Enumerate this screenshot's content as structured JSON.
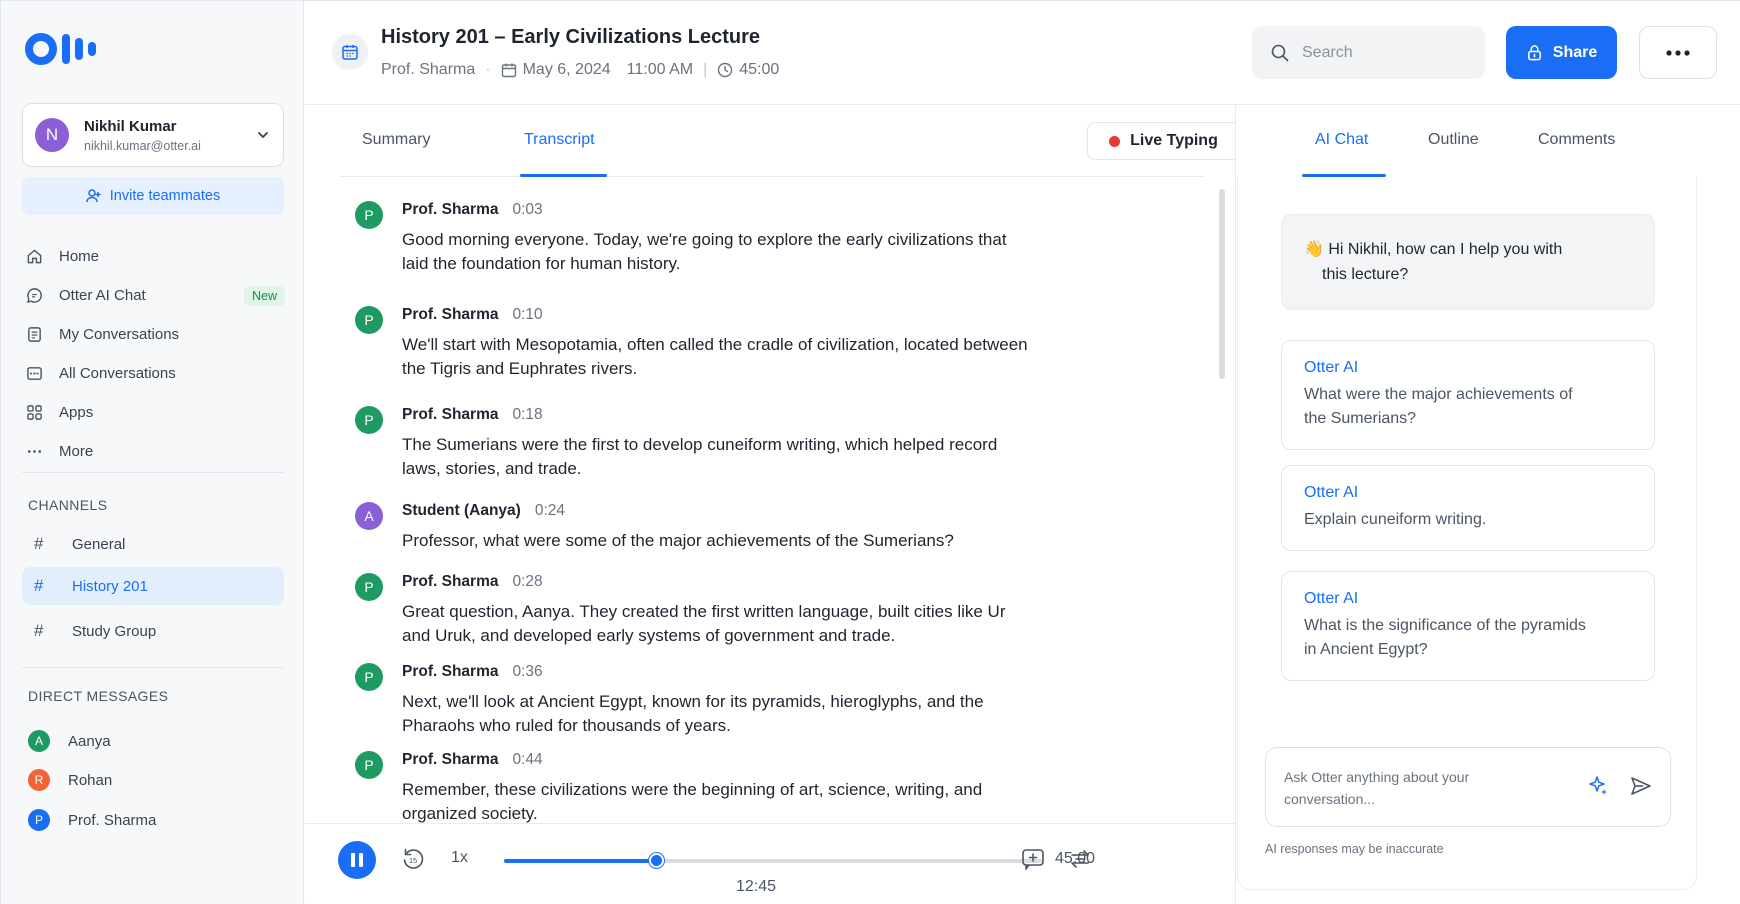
{
  "colors": {
    "accent": "#1a6ef5",
    "green_avatar": "#1e9a63",
    "purple_avatar": "#8b5fd6",
    "orange_avatar": "#f06437",
    "blue_avatar": "#1a6ef5",
    "live_dot": "#e53935"
  },
  "sidebar": {
    "user": {
      "initial": "N",
      "name": "Nikhil Kumar",
      "email": "nikhil.kumar@otter.ai"
    },
    "invite_label": "Invite teammates",
    "nav": [
      {
        "label": "Home",
        "icon": "home-icon"
      },
      {
        "label": "Otter AI Chat",
        "icon": "chat-icon",
        "badge": "New"
      },
      {
        "label": "My Conversations",
        "icon": "document-icon"
      },
      {
        "label": "All Conversations",
        "icon": "conversations-icon"
      },
      {
        "label": "Apps",
        "icon": "grid-icon"
      },
      {
        "label": "More",
        "icon": "more-dots-icon"
      }
    ],
    "channels_title": "CHANNELS",
    "channels": [
      {
        "label": "General"
      },
      {
        "label": "History 201"
      },
      {
        "label": "Study Group"
      }
    ],
    "dm_title": "DIRECT MESSAGES",
    "dms": [
      {
        "initial": "A",
        "name": "Aanya"
      },
      {
        "initial": "R",
        "name": "Rohan"
      },
      {
        "initial": "P",
        "name": "Prof. Sharma"
      }
    ]
  },
  "header": {
    "title": "History 201 – Early Civilizations Lecture",
    "speaker": "Prof. Sharma",
    "date": "May 6, 2024",
    "time": "11:00 AM",
    "duration": "45:00",
    "search_placeholder": "Search",
    "share_label": "Share"
  },
  "transcript_tabs": {
    "summary": "Summary",
    "transcript": "Transcript",
    "live_typing": "Live Typing"
  },
  "transcript": [
    {
      "initial": "P",
      "speaker": "Prof. Sharma",
      "time": "0:03",
      "text": "Good morning everyone. Today, we're going to explore the early civilizations that laid the foundation for human history."
    },
    {
      "initial": "P",
      "speaker": "Prof. Sharma",
      "time": "0:10",
      "text": "We'll start with Mesopotamia, often called the cradle of civilization, located between the Tigris and Euphrates rivers."
    },
    {
      "initial": "P",
      "speaker": "Prof. Sharma",
      "time": "0:18",
      "text": "The Sumerians were the first to develop cuneiform writing, which helped record laws, stories, and trade."
    },
    {
      "initial": "A",
      "speaker": "Student (Aanya)",
      "time": "0:24",
      "text": "Professor, what were some of the major achievements of the Sumerians?"
    },
    {
      "initial": "P",
      "speaker": "Prof. Sharma",
      "time": "0:28",
      "text": "Great question, Aanya. They created the first written language, built cities like Ur and Uruk, and developed early systems of government and trade."
    },
    {
      "initial": "P",
      "speaker": "Prof. Sharma",
      "time": "0:36",
      "text": "Next, we'll look at Ancient Egypt, known for its pyramids, hieroglyphs, and the Pharaohs who ruled for thousands of years."
    },
    {
      "initial": "P",
      "speaker": "Prof. Sharma",
      "time": "0:44",
      "text": "Remember, these civilizations were the beginning of art, science, writing, and organized society."
    }
  ],
  "player": {
    "speed": "1x",
    "current": "12:45",
    "total": "45:00",
    "progress": 0.283
  },
  "right_panel": {
    "tabs": {
      "ai_chat": "AI Chat",
      "outline": "Outline",
      "comments": "Comments"
    },
    "greeting_line1": "👋 Hi Nikhil, how can I help you with",
    "greeting_line2": "this lecture?",
    "suggestions": [
      {
        "source": "Otter AI",
        "question": "What were the major achievements of the Sumerians?"
      },
      {
        "source": "Otter AI",
        "question": "Explain cuneiform writing."
      },
      {
        "source": "Otter AI",
        "question": "What is the significance of the pyramids in Ancient Egypt?"
      }
    ],
    "ask_placeholder": "Ask Otter anything about your conversation...",
    "disclaimer": "AI responses may be inaccurate"
  }
}
